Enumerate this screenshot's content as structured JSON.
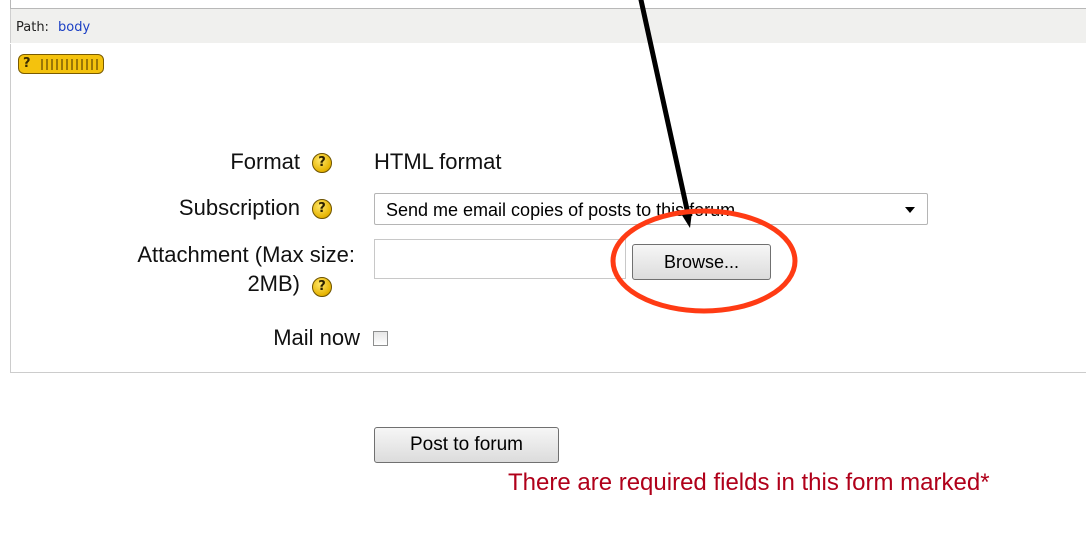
{
  "editor": {
    "path_label": "Path:",
    "path_value": "body"
  },
  "form": {
    "format": {
      "label": "Format",
      "value": "HTML format",
      "help_icon": "help-icon"
    },
    "subscription": {
      "label": "Subscription",
      "selected": "Send me email copies of posts to this forum",
      "help_icon": "help-icon"
    },
    "attachment": {
      "label_line1": "Attachment (Max size:",
      "label_line2": "2MB)",
      "value": "",
      "browse_label": "Browse...",
      "help_icon": "help-icon"
    },
    "mail_now": {
      "label": "Mail now",
      "checked": false
    },
    "submit_label": "Post to forum",
    "required_note": "There are required fields in this form marked*"
  },
  "colors": {
    "annotation_circle": "#ff3b14",
    "annotation_arrow": "#000000",
    "required_text": "#b0001a",
    "help_icon": "#f4c20d",
    "link": "#1a3fc4"
  },
  "icons": {
    "keyboard_help": "keyboard-help-icon",
    "help": "help-icon",
    "select_arrow": "chevron-down-icon"
  }
}
